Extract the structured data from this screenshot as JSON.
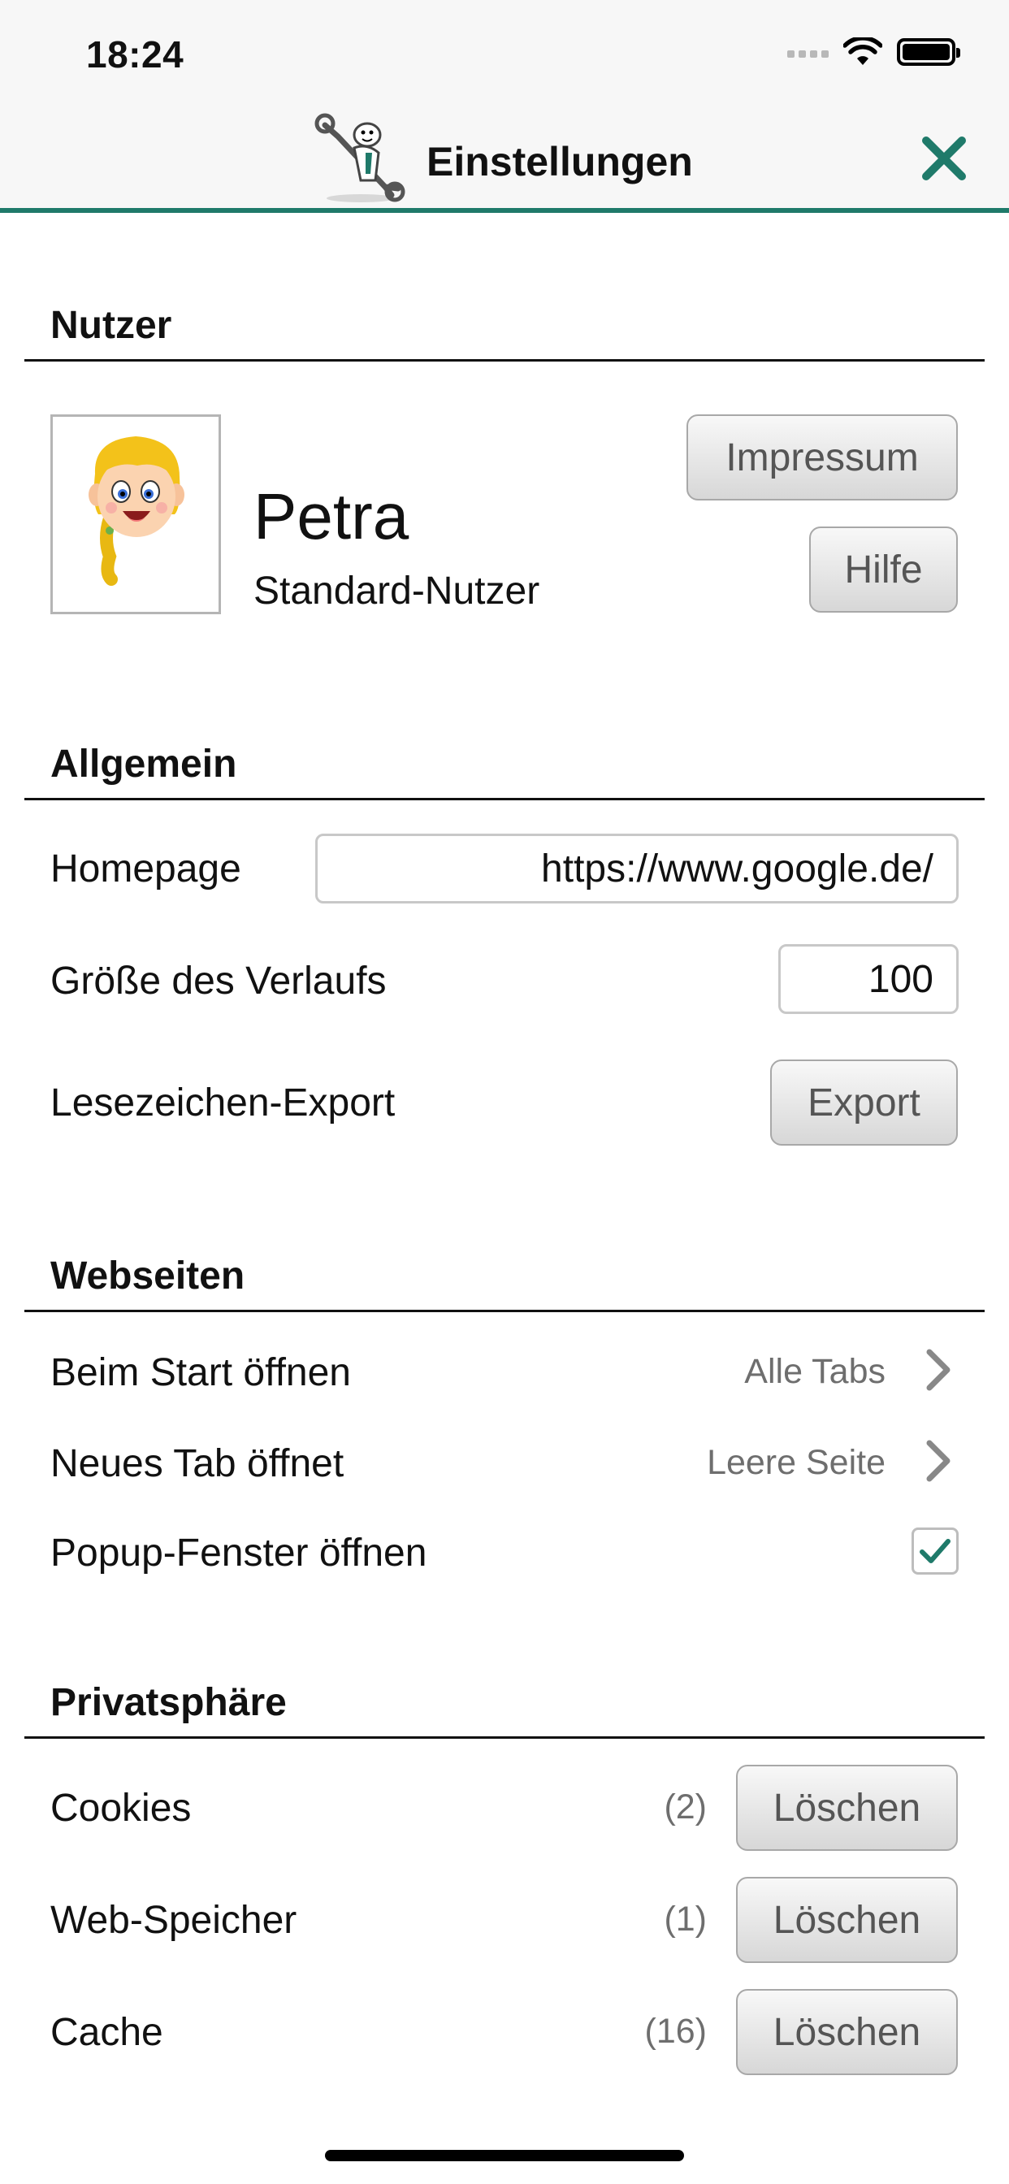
{
  "status_bar": {
    "time": "18:24"
  },
  "nav": {
    "title": "Einstellungen",
    "logo_icon": "wrench-mascot-icon",
    "close_icon": "close-icon",
    "accent": "#1f7a6a"
  },
  "sections": {
    "user": "Nutzer",
    "general": "Allgemein",
    "websites": "Webseiten",
    "privacy": "Privatsphäre"
  },
  "user": {
    "name": "Petra",
    "role": "Standard-Nutzer",
    "impressum_label": "Impressum",
    "help_label": "Hilfe"
  },
  "general": {
    "homepage_label": "Homepage",
    "homepage_value": "https://www.google.de/",
    "history_label": "Größe des Verlaufs",
    "history_value": "100",
    "bookmark_label": "Lesezeichen-Export",
    "export_label": "Export"
  },
  "websites": {
    "startup_label": "Beim Start öffnen",
    "startup_value": "Alle Tabs",
    "newtab_label": "Neues Tab öffnet",
    "newtab_value": "Leere Seite",
    "popup_label": "Popup-Fenster öffnen",
    "popup_checked": true
  },
  "privacy": {
    "cookies_label": "Cookies",
    "cookies_count": "(2)",
    "storage_label": "Web-Speicher",
    "storage_count": "(1)",
    "cache_label": "Cache",
    "cache_count": "(16)",
    "delete_label": "Löschen"
  }
}
